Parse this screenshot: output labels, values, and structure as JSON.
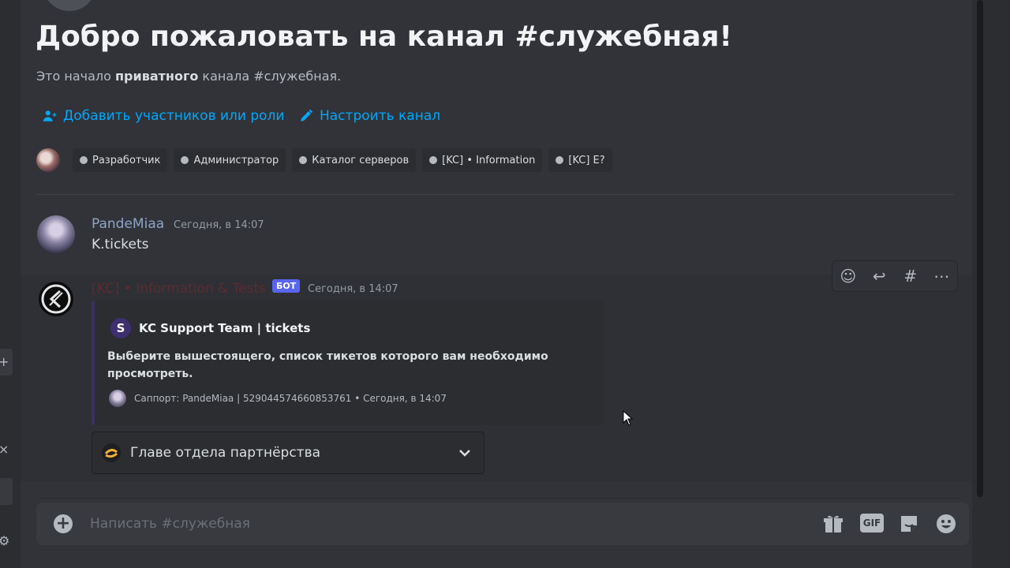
{
  "colors": {
    "background": "#313338",
    "link": "#00a8fc",
    "bot_badge": "#5865f2",
    "user1_name": "#8fa3c8",
    "bot_name": "#5b2b30",
    "embed_stripe": "#3c2e63"
  },
  "welcome": {
    "title": "Добро пожаловать на канал #служебная!",
    "subtitle_before": "Это начало ",
    "subtitle_bold": "приватного",
    "subtitle_after": " канала #служебная."
  },
  "actions": {
    "add_members": "Добавить участников или роли",
    "add_members_icon": "add-user-icon",
    "edit_channel": "Настроить канал",
    "edit_channel_icon": "pencil-icon"
  },
  "roles": [
    {
      "label": "Разработчик"
    },
    {
      "label": "Администратор"
    },
    {
      "label": "Каталог серверов"
    },
    {
      "label": "[KC] • Information"
    },
    {
      "label": "[KC] E?"
    }
  ],
  "messages": [
    {
      "author": "PandeMiaa",
      "timestamp": "Сегодня, в 14:07",
      "text": "K.tickets"
    },
    {
      "author": "[KC] • Information & Tests",
      "badge": "БОТ",
      "timestamp": "Сегодня, в 14:07",
      "embed": {
        "author_icon_letter": "S",
        "author": "KC Support Team | tickets",
        "description": "Выберите вышестоящего, список тикетов которого вам необходимо просмотреть.",
        "footer": "Саппорт: PandeMiaa | 529044574660853761 • Сегодня, в 14:07"
      },
      "select": {
        "value": "Главе отдела партнёрства",
        "icon": "partnership-icon"
      }
    }
  ],
  "message_toolbar": {
    "icons": [
      "add-reaction-icon",
      "reply-icon",
      "create-thread-icon",
      "more-icon"
    ]
  },
  "composer": {
    "placeholder": "Написать #служебная",
    "buttons": [
      "gift-icon",
      "gif-icon",
      "sticker-icon",
      "emoji-icon"
    ],
    "gif_label": "GIF"
  }
}
